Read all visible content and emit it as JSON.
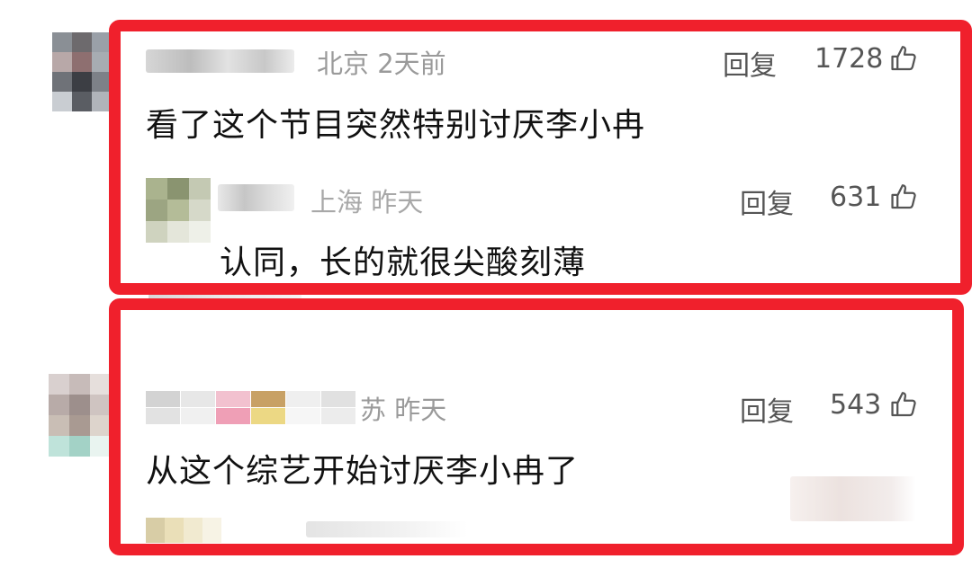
{
  "comments": [
    {
      "location_time": "北京 2天前",
      "reply_label": "回复",
      "likes": "1728",
      "text": "看了这个节目突然特别讨厌李小冉",
      "replies": [
        {
          "location_time": "上海 昨天",
          "reply_label": "回复",
          "likes": "631",
          "text": "认同，长的就很尖酸刻薄"
        }
      ]
    },
    {
      "location_time": "苏 昨天",
      "reply_label": "回复",
      "likes": "543",
      "text": "从这个综艺开始讨厌李小冉了"
    }
  ],
  "icons": {
    "like": "thumbs-up-icon"
  },
  "colors": {
    "highlight_frame": "#f0202c",
    "meta_text": "#9a9a9a",
    "comment_text": "#111111"
  }
}
